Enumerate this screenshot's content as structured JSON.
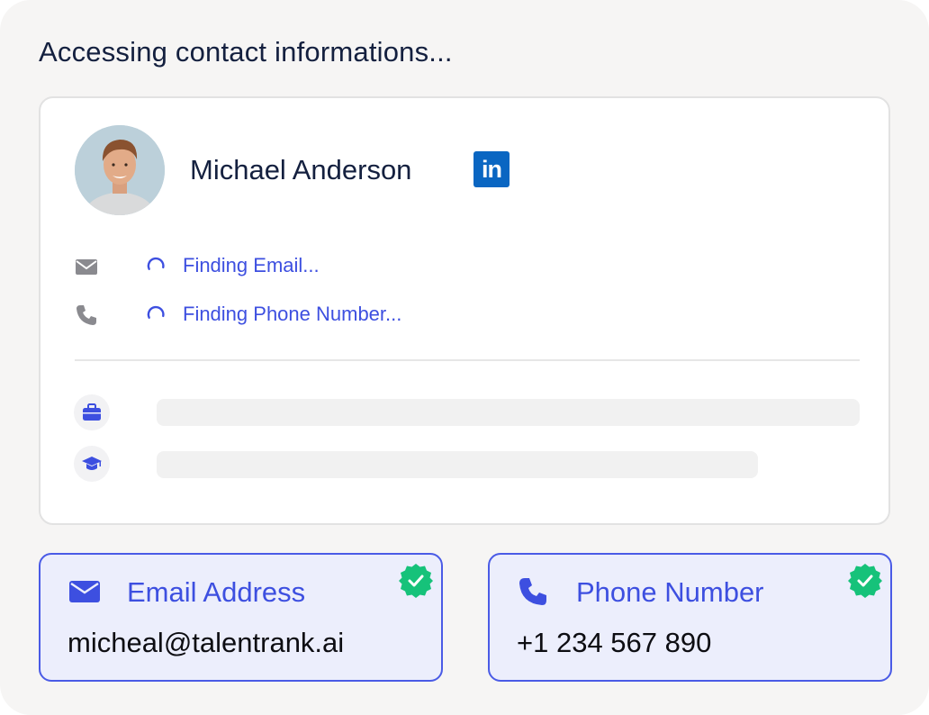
{
  "heading": "Accessing contact informations...",
  "profile": {
    "name": "Michael Anderson",
    "linkedin_label": "in",
    "linkedin_color": "#0a66c2"
  },
  "status": {
    "email": "Finding Email...",
    "phone": "Finding Phone Number..."
  },
  "icons": {
    "email_row": "envelope-icon",
    "phone_row": "phone-icon",
    "work": "briefcase-icon",
    "education": "graduation-cap-icon",
    "verified": "verified-badge-icon"
  },
  "results": {
    "email": {
      "label": "Email Address",
      "value": "micheal@talentrank.ai"
    },
    "phone": {
      "label": "Phone Number",
      "value": "+1 234 567 890"
    }
  },
  "colors": {
    "accent": "#3d4fe0",
    "verified": "#16c27a",
    "text": "#14203f"
  }
}
